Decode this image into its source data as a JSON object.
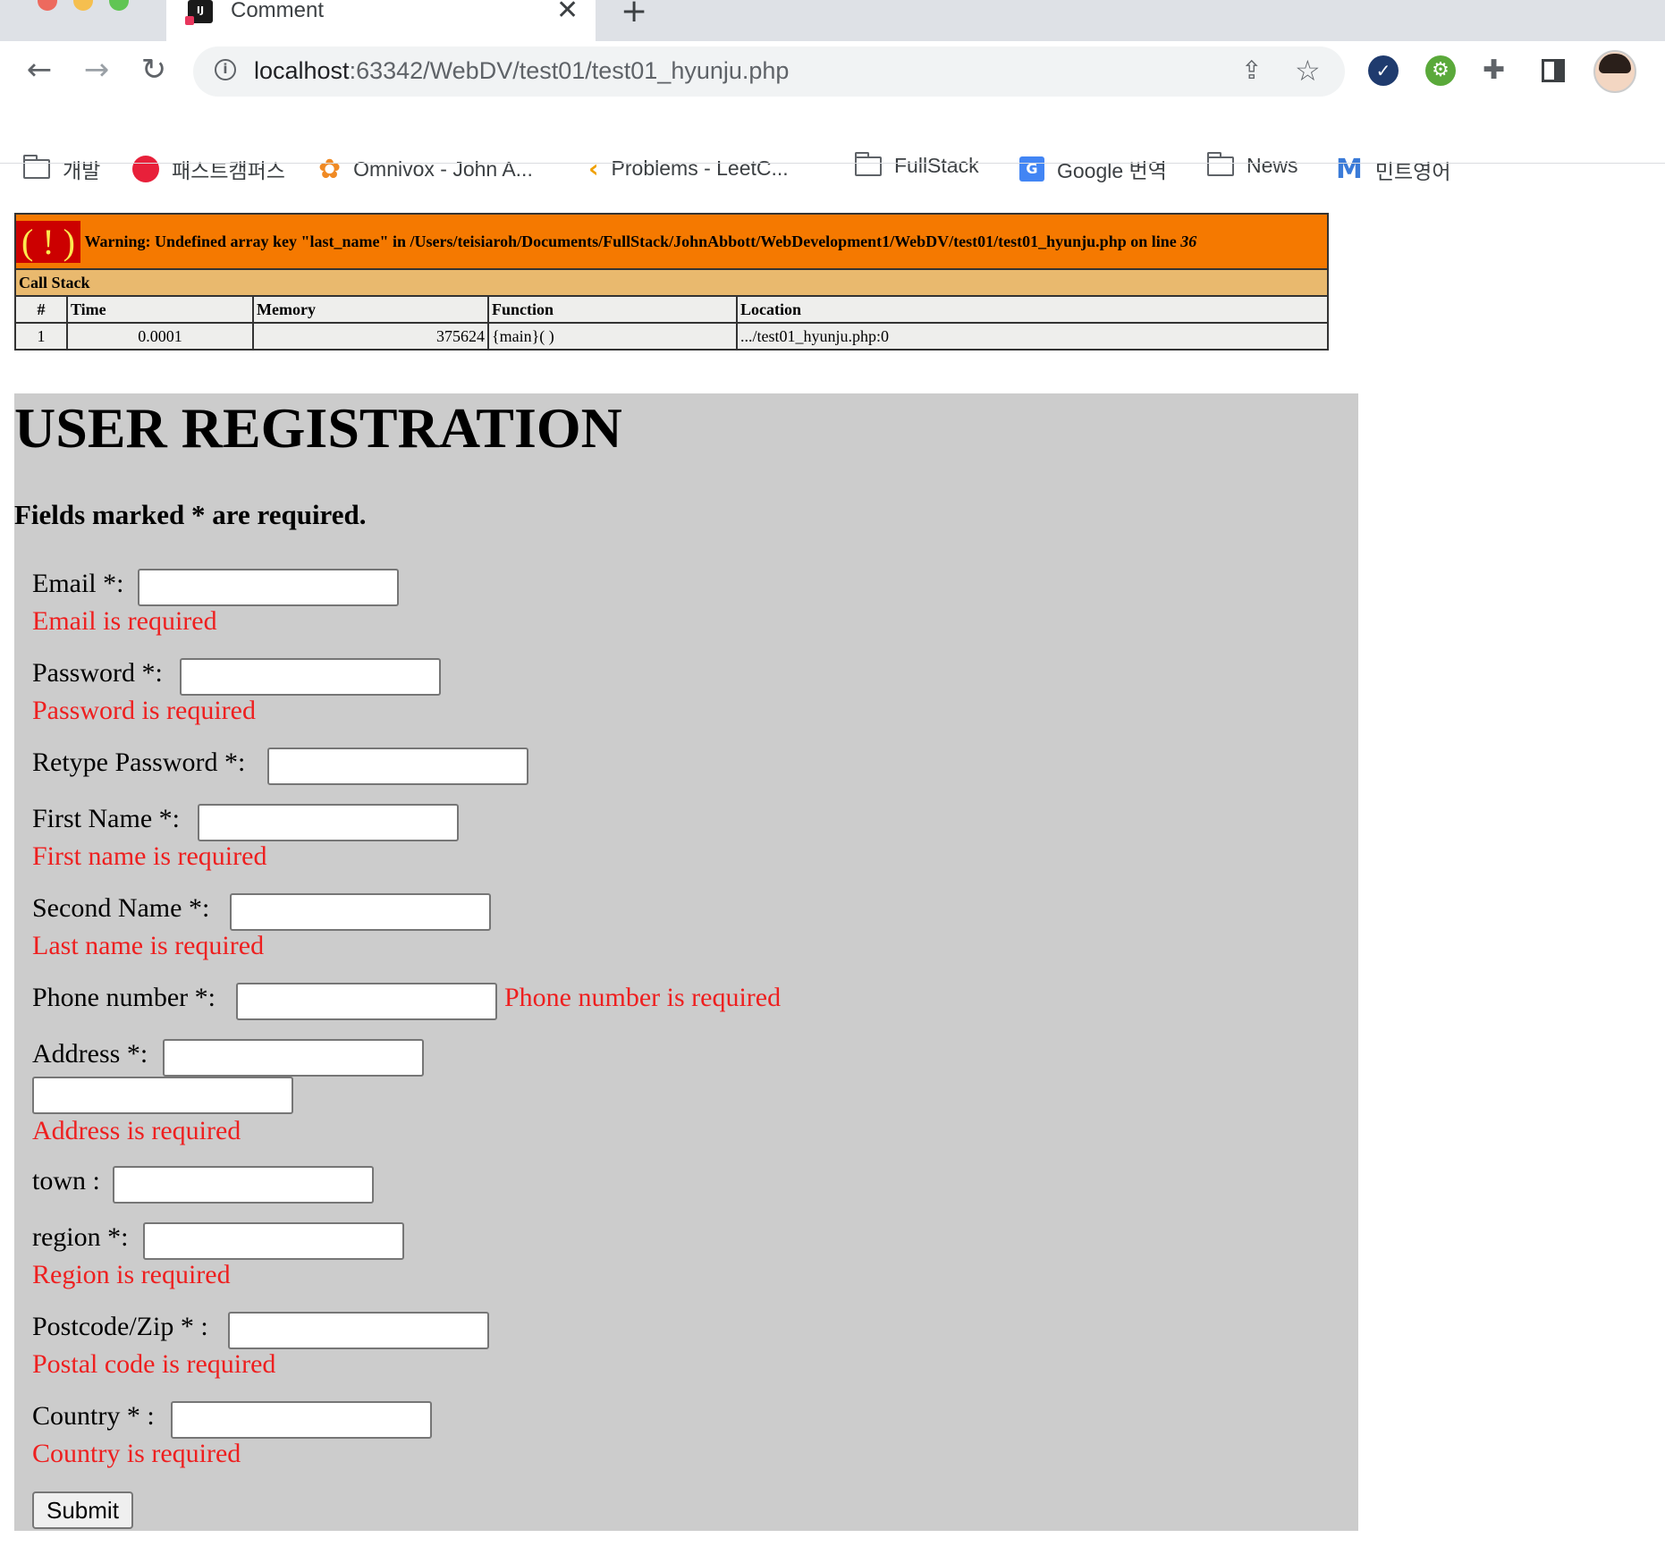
{
  "browser": {
    "tab_title": "Comment",
    "tab_close": "✕",
    "new_tab": "+",
    "url_host": "localhost",
    "url_rest": ":63342/WebDV/test01/test01_hyunju.php",
    "favicon_text": "IJ",
    "bookmarks": [
      {
        "label": "개발",
        "icon": "folder-icon"
      },
      {
        "label": "패스트캠퍼스",
        "icon": "fastcampus-icon"
      },
      {
        "label": "Omnivox - John A...",
        "icon": "omnivox-icon"
      },
      {
        "label": "Problems - LeetC...",
        "icon": "leetcode-icon"
      },
      {
        "label": "FullStack",
        "icon": "folder-icon"
      },
      {
        "label": "Google 번역",
        "icon": "google-translate-icon"
      },
      {
        "label": "News",
        "icon": "folder-icon"
      },
      {
        "label": "민트영어",
        "icon": "mint-icon"
      }
    ]
  },
  "xdebug": {
    "bang": "( ! )",
    "warning": "Warning: Undefined array key \"last_name\" in /Users/teisiaroh/Documents/FullStack/JohnAbbott/WebDevelopment1/WebDV/test01/test01_hyunju.php on line ",
    "line": "36",
    "call_stack": "Call Stack",
    "headers": [
      "#",
      "Time",
      "Memory",
      "Function",
      "Location"
    ],
    "row": {
      "num": "1",
      "time": "0.0001",
      "memory": "375624",
      "function": "{main}( )",
      "location": ".../test01_hyunju.php:0"
    }
  },
  "form": {
    "title": "USER REGISTRATION",
    "note": "Fields marked * are required.",
    "email_label": "Email *:",
    "email_error": "Email is required",
    "password_label": "Password *:",
    "password_error": "Password is required",
    "retype_label": "Retype Password *:",
    "first_name_label": "First Name *:",
    "first_name_error": "First name is required",
    "second_name_label": "Second Name *:",
    "second_name_error": "Last name is required",
    "phone_label": "Phone number *:",
    "phone_error": "Phone number is required",
    "address_label": "Address *:",
    "address_error": "Address is required",
    "town_label": "town :",
    "region_label": "region *:",
    "region_error": "Region is required",
    "postcode_label": "Postcode/Zip * :",
    "postcode_error": "Postal code is required",
    "country_label": "Country * :",
    "country_error": "Country is required",
    "submit_label": "Submit"
  },
  "colors": {
    "error_text": "#ee1f1f",
    "panel_bg": "#cccccc",
    "xdebug_warning_bg": "#f57900",
    "xdebug_bang_bg": "#cc0000",
    "xdebug_callstack_bg": "#e9b96e"
  }
}
